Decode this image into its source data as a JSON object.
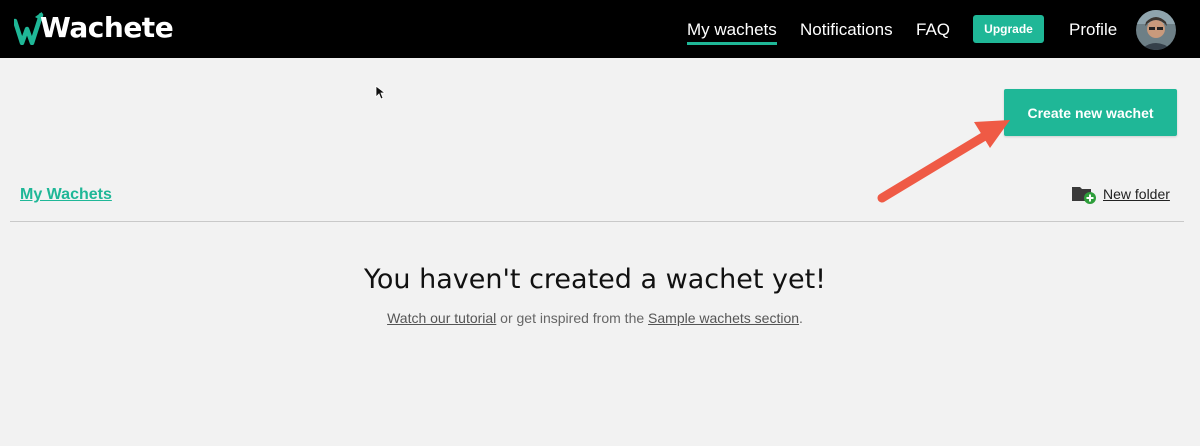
{
  "brand": {
    "name": "Wachete",
    "accent": "#1fb797"
  },
  "nav": {
    "items": [
      {
        "label": "My wachets",
        "active": true
      },
      {
        "label": "Notifications",
        "active": false
      },
      {
        "label": "FAQ",
        "active": false
      }
    ],
    "upgrade_label": "Upgrade",
    "profile_label": "Profile"
  },
  "actions": {
    "create_label": "Create new wachet"
  },
  "section": {
    "title": "My Wachets",
    "new_folder_label": "New folder"
  },
  "empty_state": {
    "title": "You haven't created a wachet yet!",
    "tutorial_link": "Watch our tutorial",
    "middle_text": " or get inspired from the ",
    "samples_link": "Sample wachets section",
    "end_text": "."
  },
  "annotation": {
    "arrow_color": "#ef5a45"
  }
}
